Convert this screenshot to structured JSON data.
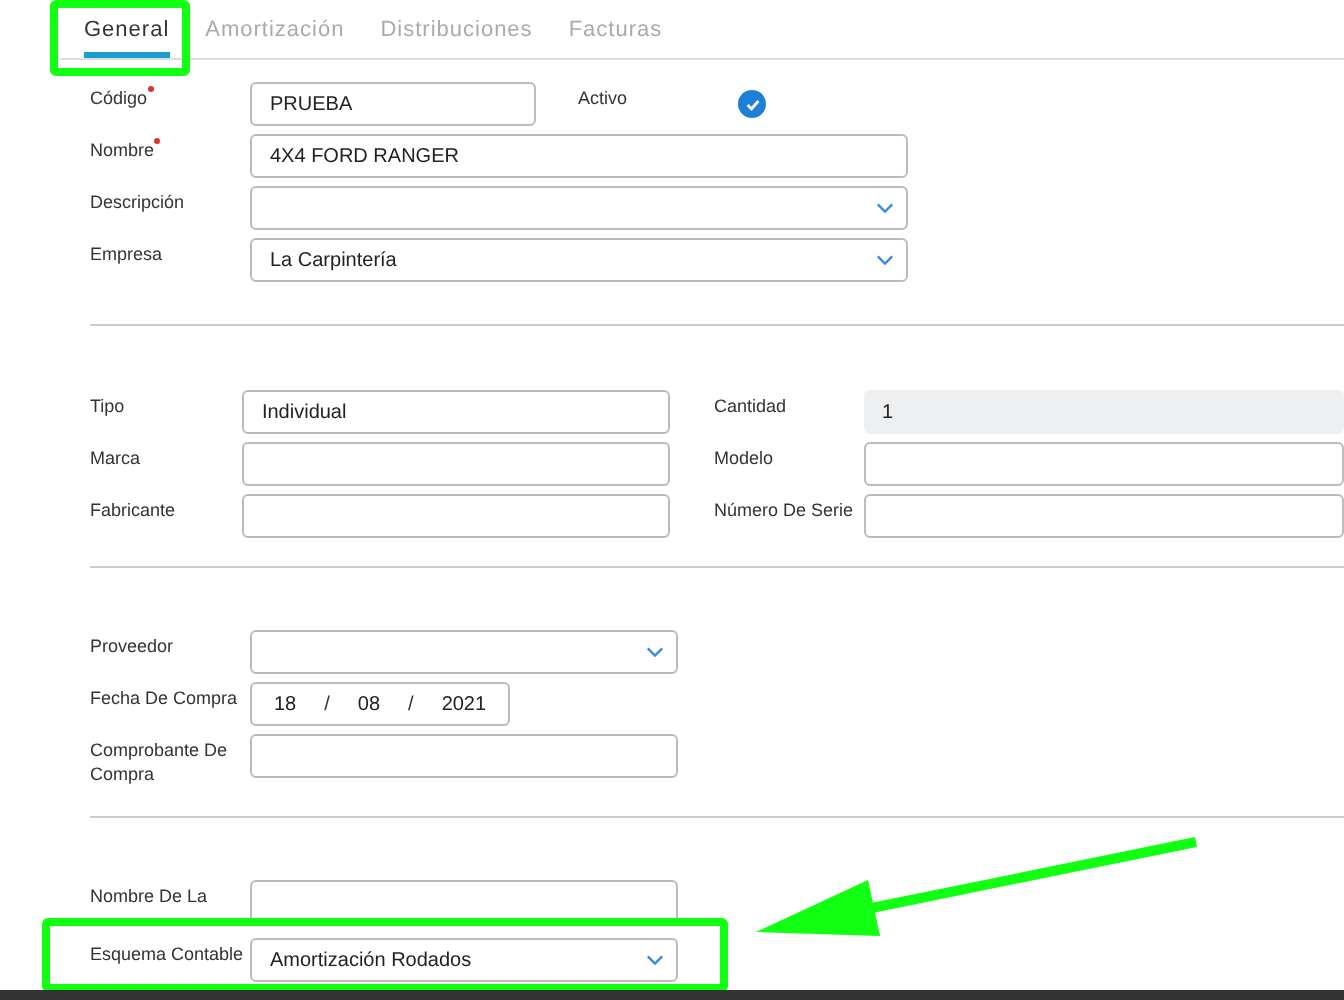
{
  "tabs": [
    {
      "label": "General",
      "selected": true
    },
    {
      "label": "Amortización",
      "selected": false
    },
    {
      "label": "Distribuciones",
      "selected": false
    },
    {
      "label": "Facturas",
      "selected": false
    }
  ],
  "sections": [
    {
      "rows": [
        [
          {
            "label": "Código",
            "required": true,
            "kind": "text",
            "value": "PRUEBA"
          },
          {
            "label": "Activo",
            "kind": "checkbox",
            "checked": true
          }
        ],
        [
          {
            "label": "Nombre",
            "required": true,
            "kind": "text",
            "value": "4X4 FORD RANGER"
          }
        ],
        [
          {
            "label": "Descripción",
            "kind": "select"
          }
        ],
        [
          {
            "label": "Empresa",
            "kind": "select",
            "value": "La Carpintería"
          }
        ]
      ]
    },
    {
      "rows": [
        [
          {
            "label": "Tipo",
            "kind": "text",
            "value": "Individual"
          },
          {
            "label": "Cantidad",
            "kind": "readonly",
            "value": "1"
          }
        ],
        [
          {
            "label": "Marca",
            "kind": "text"
          },
          {
            "label": "Modelo",
            "kind": "text"
          }
        ],
        [
          {
            "label": "Fabricante",
            "kind": "text"
          },
          {
            "label": "Número De Serie",
            "kind": "text"
          }
        ]
      ]
    },
    {
      "rows": [
        [
          {
            "label": "Proveedor",
            "kind": "select"
          }
        ],
        [
          {
            "label": "Fecha De Compra",
            "kind": "date",
            "day": "18",
            "month": "08",
            "year": "2021",
            "separator": "/"
          }
        ],
        [
          {
            "label": "Comprobante De Compra",
            "kind": "text"
          }
        ]
      ]
    },
    {
      "rows": [
        [
          {
            "label": "Nombre De La",
            "kind": "text"
          }
        ],
        [
          {
            "label": "Esquema Contable",
            "kind": "select",
            "value": "Amortización Rodados"
          }
        ]
      ]
    }
  ]
}
